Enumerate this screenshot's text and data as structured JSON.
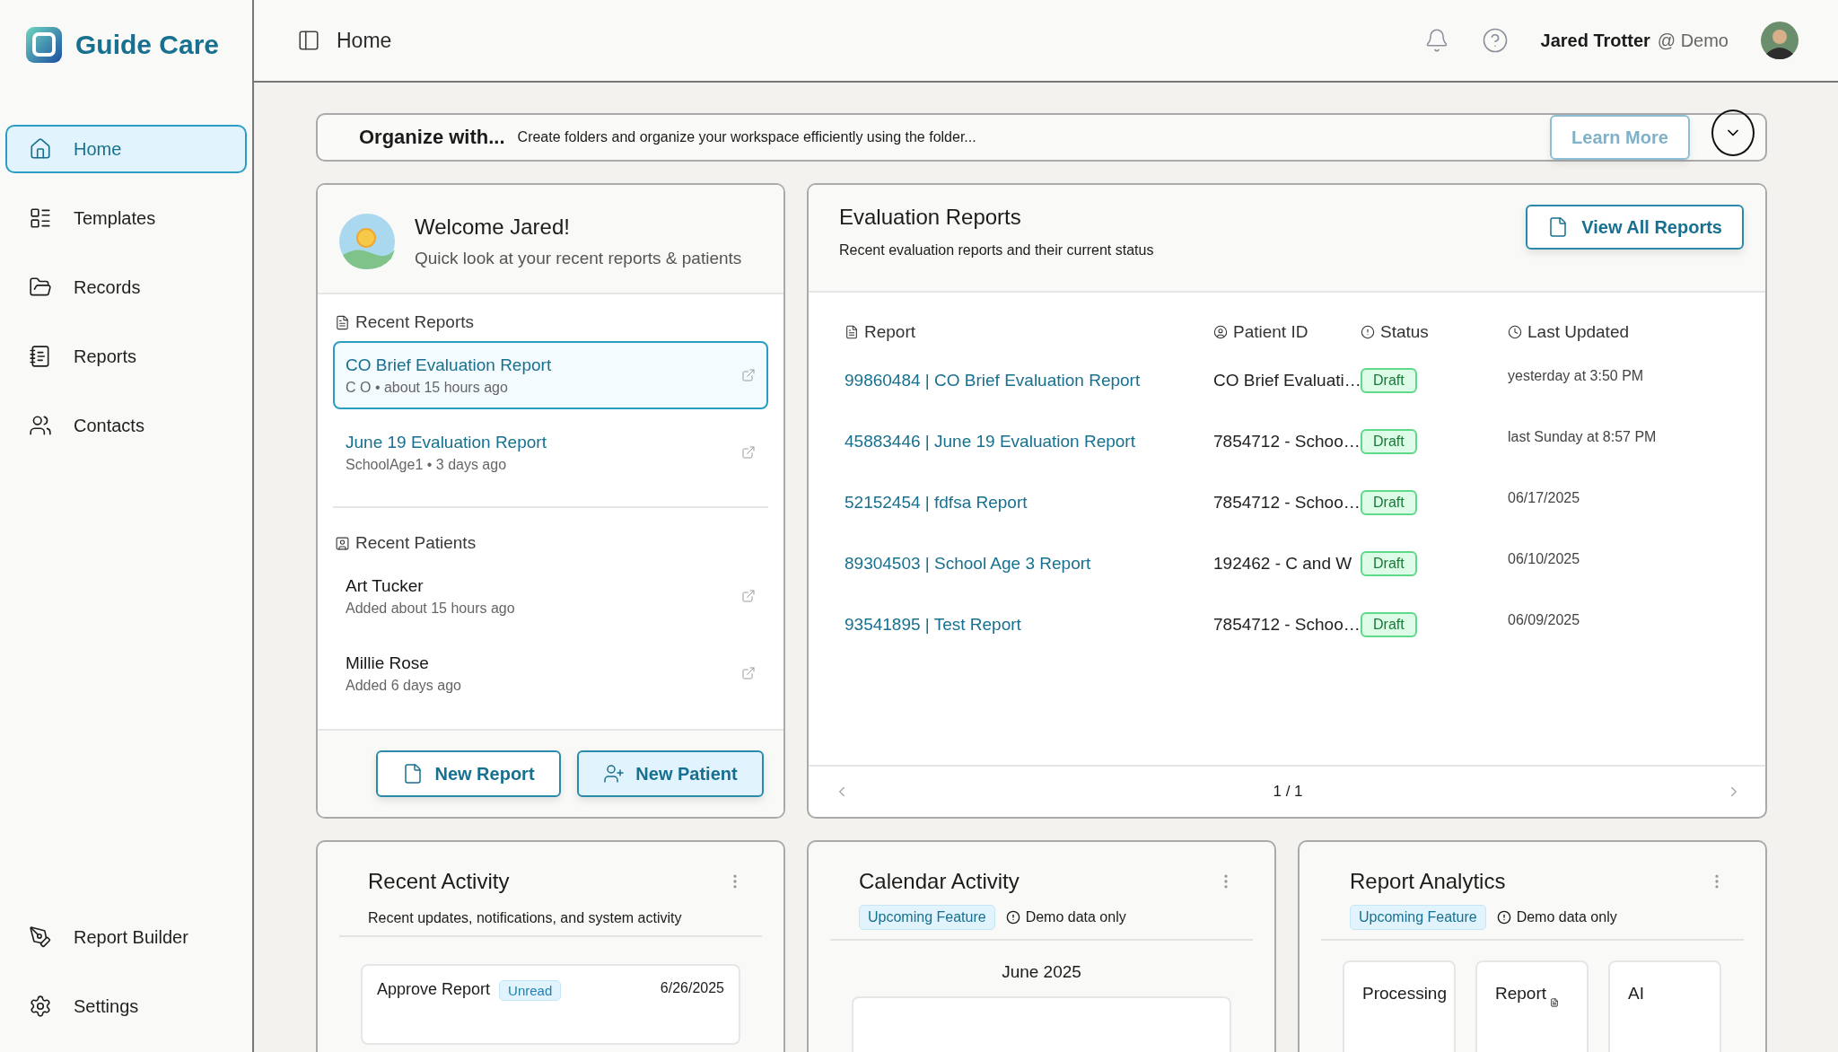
{
  "app": {
    "name": "Guide Care"
  },
  "sidebar": {
    "items": [
      {
        "label": "Home",
        "selected": true
      },
      {
        "label": "Templates",
        "selected": false
      },
      {
        "label": "Records",
        "selected": false
      },
      {
        "label": "Reports",
        "selected": false
      },
      {
        "label": "Contacts",
        "selected": false
      }
    ],
    "bottom_items": [
      {
        "label": "Report Builder"
      },
      {
        "label": "Settings"
      }
    ]
  },
  "header": {
    "title": "Home",
    "user": {
      "name": "Jared Trotter",
      "org": "@ Demo"
    }
  },
  "banner": {
    "title": "Organize with...",
    "text": "Create folders and organize your workspace efficiently using the folder...",
    "button": "Learn More"
  },
  "welcome": {
    "title": "Welcome Jared!",
    "subtitle": "Quick look at your recent reports & patients",
    "recent_reports": {
      "heading": "Recent Reports",
      "items": [
        {
          "title": "CO Brief Evaluation Report",
          "meta": "C O • about 15 hours ago",
          "selected": true
        },
        {
          "title": "June 19 Evaluation Report",
          "meta": "SchoolAge1 • 3 days ago",
          "selected": false
        }
      ]
    },
    "recent_patients": {
      "heading": "Recent Patients",
      "items": [
        {
          "name": "Art Tucker",
          "meta": "Added about 15 hours ago"
        },
        {
          "name": "Millie Rose",
          "meta": "Added 6 days ago"
        }
      ]
    },
    "buttons": [
      {
        "label": "New Report",
        "kind": "outline"
      },
      {
        "label": "New Patient",
        "kind": "filled"
      }
    ]
  },
  "evaluation": {
    "title": "Evaluation Reports",
    "subtitle": "Recent evaluation reports and their current status",
    "button": "View All Reports",
    "columns": [
      "Report",
      "Patient ID",
      "Status",
      "Last Updated"
    ],
    "rows": [
      {
        "report": "99860484 | CO Brief Evaluation Report",
        "patient_id": "CO Brief Evaluati…",
        "status": "Draft",
        "updated": "yesterday at 3:50 PM"
      },
      {
        "report": "45883446 | June 19 Evaluation Report",
        "patient_id": "7854712 - Schoo…",
        "status": "Draft",
        "updated": "last Sunday at 8:57 PM"
      },
      {
        "report": "52152454 | fdfsa Report",
        "patient_id": "7854712 - Schoo…",
        "status": "Draft",
        "updated": "06/17/2025"
      },
      {
        "report": "89304503 | School Age 3 Report",
        "patient_id": "192462 - C and W",
        "status": "Draft",
        "updated": "06/10/2025"
      },
      {
        "report": "93541895 | Test Report",
        "patient_id": "7854712 - Schoo…",
        "status": "Draft",
        "updated": "06/09/2025"
      }
    ],
    "pagination": "1 / 1"
  },
  "activity": {
    "title": "Recent Activity",
    "subtitle": "Recent updates, notifications, and system activity",
    "items": [
      {
        "title": "Approve Report",
        "badge": "Unread",
        "date": "6/26/2025"
      }
    ]
  },
  "calendar": {
    "title": "Calendar Activity",
    "feature": "Upcoming Feature",
    "note": "Demo data only",
    "month": "June 2025"
  },
  "analytics": {
    "title": "Report Analytics",
    "feature": "Upcoming Feature",
    "note": "Demo data only",
    "tiles": [
      "Processing",
      "Report",
      "AI"
    ]
  }
}
